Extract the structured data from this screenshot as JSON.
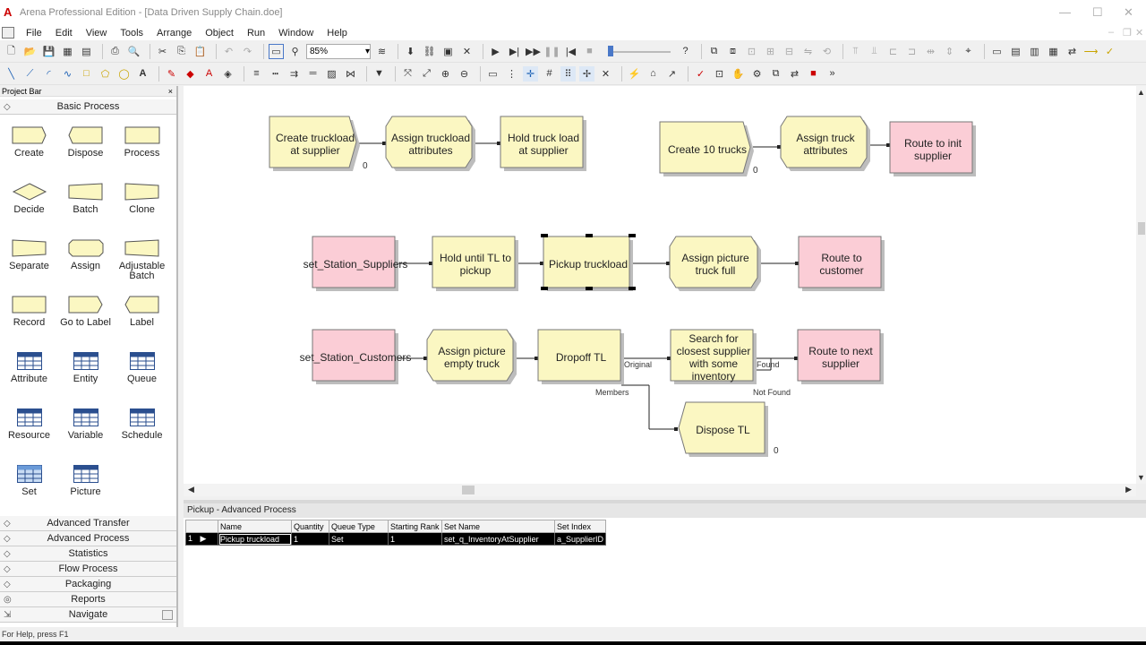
{
  "window": {
    "title": "Arena Professional Edition - [Data Driven Supply Chain.doe]",
    "app_icon": "A"
  },
  "menu": [
    "File",
    "Edit",
    "View",
    "Tools",
    "Arrange",
    "Object",
    "Run",
    "Window",
    "Help"
  ],
  "toolbar": {
    "zoom": "85%"
  },
  "project_bar": {
    "title": "Project Bar",
    "close": "×",
    "active_panel": "Basic Process",
    "shapes": [
      {
        "label": "Create",
        "shape": "create"
      },
      {
        "label": "Dispose",
        "shape": "dispose"
      },
      {
        "label": "Process",
        "shape": "process"
      },
      {
        "label": "Decide",
        "shape": "decide"
      },
      {
        "label": "Batch",
        "shape": "batch"
      },
      {
        "label": "Clone",
        "shape": "clone"
      },
      {
        "label": "Separate",
        "shape": "separate"
      },
      {
        "label": "Assign",
        "shape": "assign"
      },
      {
        "label": "Adjustable\nBatch",
        "shape": "adjbatch"
      },
      {
        "label": "Record",
        "shape": "record"
      },
      {
        "label": "Go to Label",
        "shape": "goto"
      },
      {
        "label": "Label",
        "shape": "label"
      },
      {
        "label": "Attribute",
        "shape": "table"
      },
      {
        "label": "Entity",
        "shape": "table"
      },
      {
        "label": "Queue",
        "shape": "table"
      },
      {
        "label": "Resource",
        "shape": "table"
      },
      {
        "label": "Variable",
        "shape": "table"
      },
      {
        "label": "Schedule",
        "shape": "table"
      },
      {
        "label": "Set",
        "shape": "tableblue"
      },
      {
        "label": "Picture",
        "shape": "table"
      }
    ],
    "panels": [
      "Advanced Transfer",
      "Advanced Process",
      "Statistics",
      "Flow Process",
      "Packaging",
      "Reports",
      "Navigate"
    ]
  },
  "canvas": {
    "modules": [
      {
        "id": "m1",
        "text": "Create truckload at supplier",
        "shape": "create",
        "fill": "#fbf7c2"
      },
      {
        "id": "m2",
        "text": "Assign truckload attributes",
        "shape": "assign",
        "fill": "#fbf7c2"
      },
      {
        "id": "m3",
        "text": "Hold truck load at supplier",
        "shape": "rect",
        "fill": "#fbf7c2"
      },
      {
        "id": "m4",
        "text": "Create 10 trucks",
        "shape": "create",
        "fill": "#fbf7c2"
      },
      {
        "id": "m5",
        "text": "Assign truck attributes",
        "shape": "assign",
        "fill": "#fbf7c2"
      },
      {
        "id": "m6",
        "text": "Route to init supplier",
        "shape": "rect",
        "fill": "#fbcdd6"
      },
      {
        "id": "m7",
        "text": "set_Station_Suppliers",
        "shape": "rect",
        "fill": "#fbcdd6"
      },
      {
        "id": "m8",
        "text": "Hold until TL to pickup",
        "shape": "rect",
        "fill": "#fbf7c2"
      },
      {
        "id": "m9",
        "text": "Pickup truckload",
        "shape": "rect",
        "fill": "#fbf7c2"
      },
      {
        "id": "m10",
        "text": "Assign picture truck full",
        "shape": "assign",
        "fill": "#fbf7c2"
      },
      {
        "id": "m11",
        "text": "Route to customer",
        "shape": "rect",
        "fill": "#fbcdd6"
      },
      {
        "id": "m12",
        "text": "set_Station_Customers",
        "shape": "rect",
        "fill": "#fbcdd6"
      },
      {
        "id": "m13",
        "text": "Assign picture empty truck",
        "shape": "assign",
        "fill": "#fbf7c2"
      },
      {
        "id": "m14",
        "text": "Dropoff TL",
        "shape": "rect",
        "fill": "#fbf7c2"
      },
      {
        "id": "m15",
        "text": "Search for closest supplier with some inventory",
        "shape": "rect",
        "fill": "#fbf7c2"
      },
      {
        "id": "m16",
        "text": "Route to next supplier",
        "shape": "rect",
        "fill": "#fbcdd6"
      },
      {
        "id": "m17",
        "text": "Dispose TL",
        "shape": "dispose",
        "fill": "#fbf7c2"
      }
    ],
    "counters": [
      "0",
      "0",
      "0"
    ],
    "port_labels": {
      "original": "Original",
      "members": "Members",
      "found": "Found",
      "not_found": "Not Found"
    }
  },
  "spreadsheet": {
    "title": "Pickup - Advanced Process",
    "columns": [
      "Name",
      "Quantity",
      "Queue Type",
      "Starting Rank",
      "Set Name",
      "Set Index"
    ],
    "rows": [
      [
        "Pickup truckload",
        "1",
        "Set",
        "1",
        "set_q_InventoryAtSupplier",
        "a_SupplierID"
      ]
    ],
    "row_numbers": [
      "1"
    ]
  },
  "status": "For Help, press F1",
  "colors": {
    "module_yellow": "#fbf7c2",
    "module_pink": "#fbcdd6",
    "accent": "#4a78c8"
  }
}
